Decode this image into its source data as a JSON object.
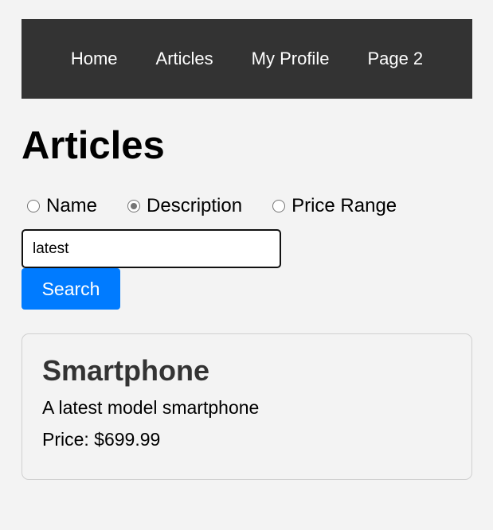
{
  "nav": {
    "items": [
      {
        "label": "Home"
      },
      {
        "label": "Articles"
      },
      {
        "label": "My Profile"
      },
      {
        "label": "Page 2"
      }
    ]
  },
  "page": {
    "title": "Articles"
  },
  "filters": {
    "options": [
      {
        "label": "Name",
        "checked": false
      },
      {
        "label": "Description",
        "checked": true
      },
      {
        "label": "Price Range",
        "checked": false
      }
    ]
  },
  "search": {
    "value": "latest",
    "button_label": "Search"
  },
  "results": [
    {
      "title": "Smartphone",
      "description": "A latest model smartphone",
      "price": "Price: $699.99"
    }
  ],
  "colors": {
    "navbar_bg": "#333333",
    "accent": "#007bff",
    "page_bg": "#f3f3f3"
  }
}
